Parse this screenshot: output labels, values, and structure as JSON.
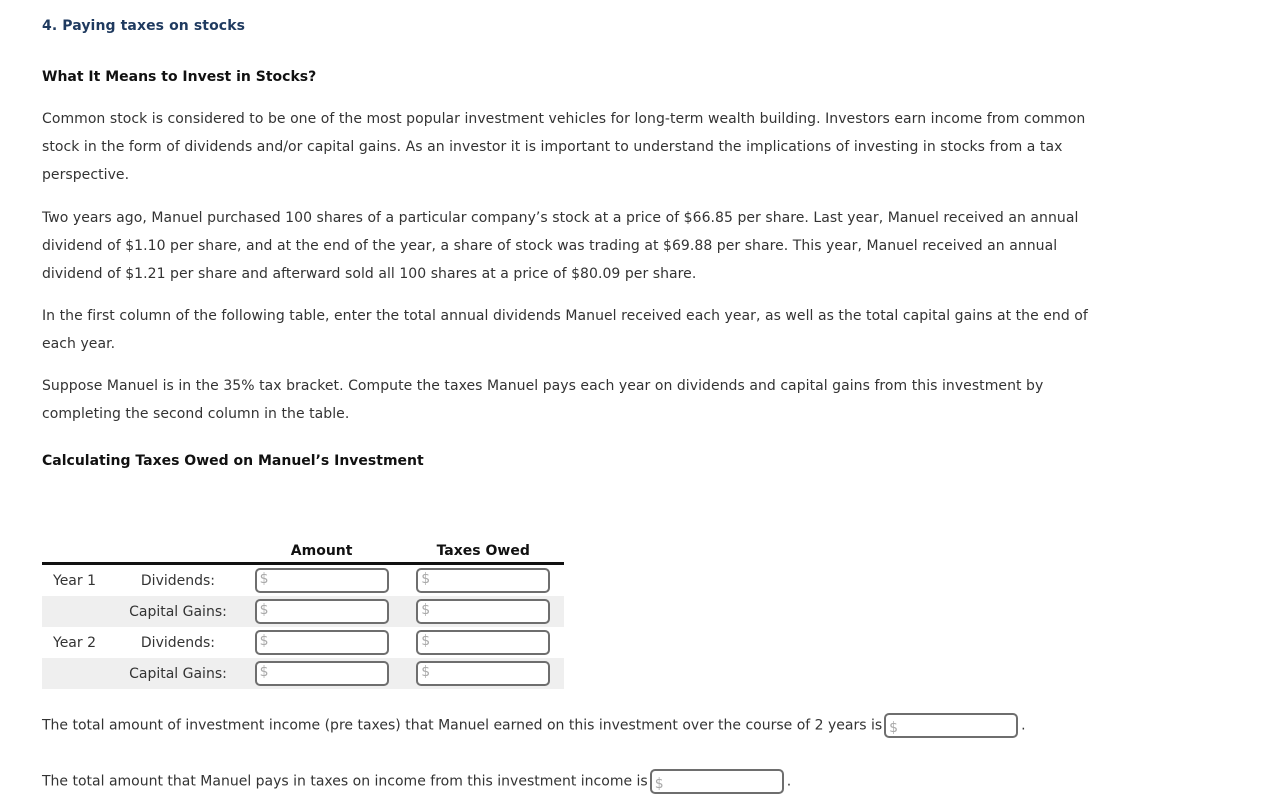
{
  "title": "4. Paying taxes on stocks",
  "section1": {
    "heading": "What It Means to Invest in Stocks?",
    "paragraphs": [
      "Common stock is considered to be one of the most popular investment vehicles for long-term wealth building. Investors earn income from common stock in the form of dividends and/or capital gains. As an investor it is important to understand the implications of investing in stocks from a tax perspective.",
      "Two years ago, Manuel purchased 100 shares of a particular company’s stock at a price of $66.85 per share. Last year, Manuel received an annual dividend of $1.10 per share, and at the end of the year, a share of stock was trading at $69.88 per share. This year, Manuel received an annual dividend of $1.21 per share and afterward sold all 100 shares at a price of $80.09 per share.",
      "In the first column of the following table, enter the total annual dividends Manuel received each year, as well as the total capital gains at the end of each year.",
      "Suppose Manuel is in the 35% tax bracket. Compute the taxes Manuel pays each year on dividends and capital gains from this investment by completing the second column in the table."
    ]
  },
  "table": {
    "heading": "Calculating Taxes Owed on Manuel’s Investment",
    "columns": [
      "",
      "",
      "Amount",
      "Taxes Owed"
    ],
    "currency_symbol": "$",
    "rows": [
      {
        "year": "Year 1",
        "label": "Dividends:",
        "amount": "",
        "taxes": ""
      },
      {
        "year": "",
        "label": "Capital Gains:",
        "amount": "",
        "taxes": ""
      },
      {
        "year": "Year 2",
        "label": "Dividends:",
        "amount": "",
        "taxes": ""
      },
      {
        "year": "",
        "label": "Capital Gains:",
        "amount": "",
        "taxes": ""
      }
    ]
  },
  "questions": [
    {
      "text": "The total amount of investment income (pre taxes) that Manuel earned on this investment over the course of 2 years is",
      "value": "",
      "suffix": "."
    },
    {
      "text": "The total amount that Manuel pays in taxes on income from this investment income is",
      "value": "",
      "suffix": "."
    }
  ]
}
